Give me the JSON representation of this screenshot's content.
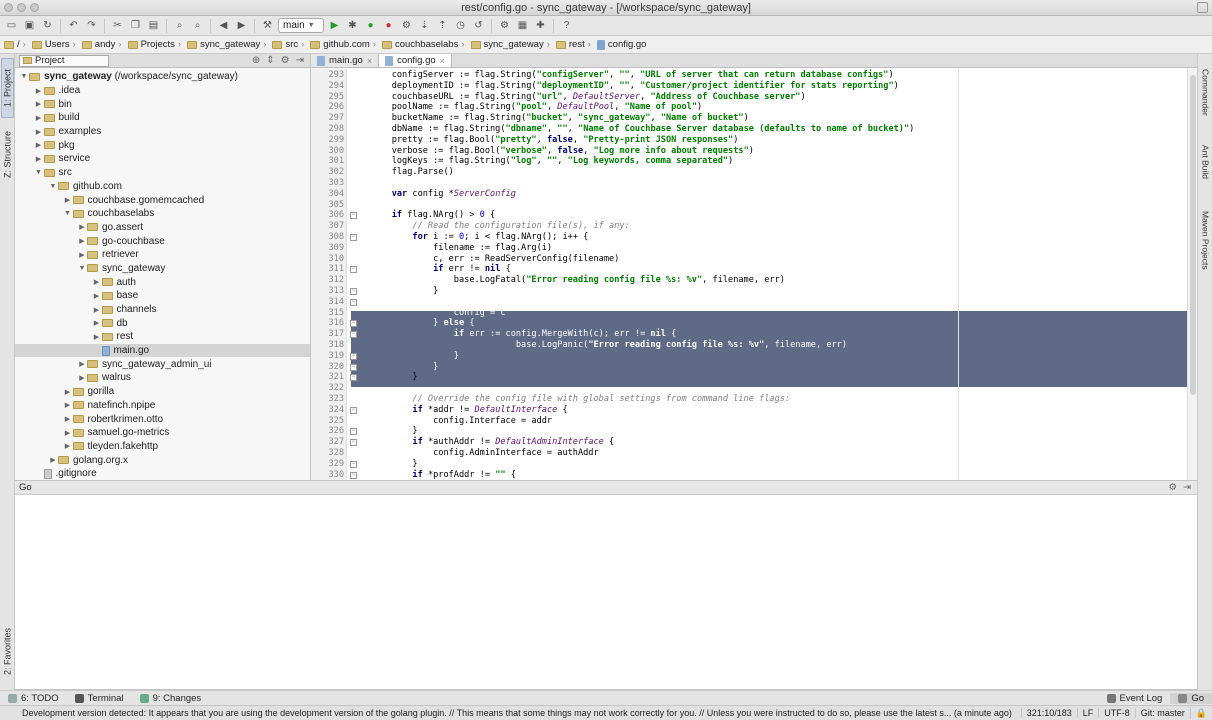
{
  "window": {
    "title": "rest/config.go - sync_gateway - [/workspace/sync_gateway]"
  },
  "toolbar": {
    "run_config": "main"
  },
  "breadcrumb": [
    {
      "label": "/",
      "kind": "folder"
    },
    {
      "label": "Users",
      "kind": "folder"
    },
    {
      "label": "andy",
      "kind": "folder"
    },
    {
      "label": "Projects",
      "kind": "folder"
    },
    {
      "label": "sync_gateway",
      "kind": "folder"
    },
    {
      "label": "src",
      "kind": "folder"
    },
    {
      "label": "github.com",
      "kind": "folder"
    },
    {
      "label": "couchbaselabs",
      "kind": "folder"
    },
    {
      "label": "sync_gateway",
      "kind": "folder"
    },
    {
      "label": "rest",
      "kind": "folder"
    },
    {
      "label": "config.go",
      "kind": "file"
    }
  ],
  "left_stripe": {
    "project_tab": "1: Project",
    "structure_tab": "Z: Structure",
    "favorites_tab": "2: Favorites"
  },
  "right_stripe": {
    "commander_tab": "Commander",
    "ant_tab": "Ant Build",
    "maven_tab": "Maven Projects"
  },
  "project_panel": {
    "selector": "Project",
    "tree": [
      {
        "label": "sync_gateway",
        "suffix": " (/workspace/sync_gateway)",
        "depth": 0,
        "state": "open",
        "icon": "folder",
        "bold": true
      },
      {
        "label": ".idea",
        "depth": 1,
        "state": "closed",
        "icon": "folder"
      },
      {
        "label": "bin",
        "depth": 1,
        "state": "closed",
        "icon": "folder"
      },
      {
        "label": "build",
        "depth": 1,
        "state": "closed",
        "icon": "folder"
      },
      {
        "label": "examples",
        "depth": 1,
        "state": "closed",
        "icon": "folder"
      },
      {
        "label": "pkg",
        "depth": 1,
        "state": "closed",
        "icon": "folder"
      },
      {
        "label": "service",
        "depth": 1,
        "state": "closed",
        "icon": "folder"
      },
      {
        "label": "src",
        "depth": 1,
        "state": "open",
        "icon": "folder"
      },
      {
        "label": "github.com",
        "depth": 2,
        "state": "open",
        "icon": "folder"
      },
      {
        "label": "couchbase.gomemcached",
        "depth": 3,
        "state": "closed",
        "icon": "folder"
      },
      {
        "label": "couchbaselabs",
        "depth": 3,
        "state": "open",
        "icon": "folder"
      },
      {
        "label": "go.assert",
        "depth": 4,
        "state": "closed",
        "icon": "folder"
      },
      {
        "label": "go-couchbase",
        "depth": 4,
        "state": "closed",
        "icon": "folder"
      },
      {
        "label": "retriever",
        "depth": 4,
        "state": "closed",
        "icon": "folder"
      },
      {
        "label": "sync_gateway",
        "depth": 4,
        "state": "open",
        "icon": "folder"
      },
      {
        "label": "auth",
        "depth": 5,
        "state": "closed",
        "icon": "folder"
      },
      {
        "label": "base",
        "depth": 5,
        "state": "closed",
        "icon": "folder"
      },
      {
        "label": "channels",
        "depth": 5,
        "state": "closed",
        "icon": "folder"
      },
      {
        "label": "db",
        "depth": 5,
        "state": "closed",
        "icon": "folder"
      },
      {
        "label": "rest",
        "depth": 5,
        "state": "closed",
        "icon": "folder"
      },
      {
        "label": "main.go",
        "depth": 5,
        "state": "none",
        "icon": "file",
        "selected": true
      },
      {
        "label": "sync_gateway_admin_ui",
        "depth": 4,
        "state": "closed",
        "icon": "folder"
      },
      {
        "label": "walrus",
        "depth": 4,
        "state": "closed",
        "icon": "folder"
      },
      {
        "label": "gorilla",
        "depth": 3,
        "state": "closed",
        "icon": "folder"
      },
      {
        "label": "natefinch.npipe",
        "depth": 3,
        "state": "closed",
        "icon": "folder"
      },
      {
        "label": "robertkrimen.otto",
        "depth": 3,
        "state": "closed",
        "icon": "folder"
      },
      {
        "label": "samuel.go-metrics",
        "depth": 3,
        "state": "closed",
        "icon": "folder"
      },
      {
        "label": "tleyden.fakehttp",
        "depth": 3,
        "state": "closed",
        "icon": "folder"
      },
      {
        "label": "golang.org.x",
        "depth": 2,
        "state": "closed",
        "icon": "folder"
      },
      {
        "label": ".gitignore",
        "depth": 1,
        "state": "none",
        "icon": "git"
      }
    ]
  },
  "editor": {
    "tabs": [
      {
        "label": "main.go",
        "active": false
      },
      {
        "label": "config.go",
        "active": true
      }
    ],
    "lines": [
      {
        "n": "293",
        "html": "\tconfigServer := flag.String(<span class=\"str\">\"configServer\"</span>, <span class=\"str\">\"\"</span>, <span class=\"str\">\"URL of server that can return database configs\"</span>)"
      },
      {
        "n": "294",
        "html": "\tdeploymentID := flag.String(<span class=\"str\">\"deploymentID\"</span>, <span class=\"str\">\"\"</span>, <span class=\"str\">\"Customer/project identifier for stats reporting\"</span>)"
      },
      {
        "n": "295",
        "html": "\tcouchbaseURL := flag.String(<span class=\"str\">\"url\"</span>, <span class=\"it\">DefaultServer</span>, <span class=\"str\">\"Address of Couchbase server\"</span>)"
      },
      {
        "n": "296",
        "html": "\tpoolName := flag.String(<span class=\"str\">\"pool\"</span>, <span class=\"it\">DefaultPool</span>, <span class=\"str\">\"Name of pool\"</span>)"
      },
      {
        "n": "297",
        "html": "\tbucketName := flag.String(<span class=\"str\">\"bucket\"</span>, <span class=\"str\">\"sync_gateway\"</span>, <span class=\"str\">\"Name of bucket\"</span>)"
      },
      {
        "n": "298",
        "html": "\tdbName := flag.String(<span class=\"str\">\"dbname\"</span>, <span class=\"str\">\"\"</span>, <span class=\"str\">\"Name of Couchbase Server database (defaults to name of bucket)\"</span>)"
      },
      {
        "n": "299",
        "html": "\tpretty := flag.Bool(<span class=\"str\">\"pretty\"</span>, <span class=\"kw\">false</span>, <span class=\"str\">\"Pretty-print JSON responses\"</span>)"
      },
      {
        "n": "300",
        "html": "\tverbose := flag.Bool(<span class=\"str\">\"verbose\"</span>, <span class=\"kw\">false</span>, <span class=\"str\">\"Log more info about requests\"</span>)"
      },
      {
        "n": "301",
        "html": "\tlogKeys := flag.String(<span class=\"str\">\"log\"</span>, <span class=\"str\">\"\"</span>, <span class=\"str\">\"Log keywords, comma separated\"</span>)"
      },
      {
        "n": "302",
        "html": "\tflag.Parse()"
      },
      {
        "n": "303",
        "html": ""
      },
      {
        "n": "304",
        "html": "\t<span class=\"kw\">var</span> config *<span class=\"it\">ServerConfig</span>"
      },
      {
        "n": "305",
        "html": ""
      },
      {
        "n": "306",
        "html": "\t<span class=\"kw\">if</span> flag.NArg() &gt; <span class=\"num\">0</span> {"
      },
      {
        "n": "307",
        "html": "\t\t<span class=\"cm\">// Read the configuration file(s), if any:</span>"
      },
      {
        "n": "308",
        "html": "\t\t<span class=\"kw\">for</span> i := <span class=\"num\">0</span>; i &lt; flag.NArg(); i++ {"
      },
      {
        "n": "309",
        "html": "\t\t\tfilename := flag.Arg(i)"
      },
      {
        "n": "310",
        "html": "\t\t\tc, err := ReadServerConfig(filename)"
      },
      {
        "n": "311",
        "html": "\t\t\t<span class=\"kw\">if</span> err != <span class=\"kw\">nil</span> {"
      },
      {
        "n": "312",
        "html": "\t\t\t\tbase.LogFatal(<span class=\"str\">\"Error reading config file %s: %v\"</span>, filename, err)"
      },
      {
        "n": "313",
        "html": "\t\t\t}"
      },
      {
        "n": "314",
        "html": "\t\t\t<span class=\"kw\">if</span> config == <span class=\"kw\">nil</span> {",
        "sel": true
      },
      {
        "n": "315",
        "html": "\t\t\t\tconfig = c",
        "sel": true
      },
      {
        "n": "316",
        "html": "\t\t\t} <span class=\"kw\">else</span> {",
        "sel": true
      },
      {
        "n": "317",
        "html": "\t\t\t\t<span class=\"kw\">if</span> err := config.MergeWith(c); err != <span class=\"kw\">nil</span> {",
        "sel": true
      },
      {
        "n": "318",
        "html": "\t\t\t\t\t\t\tbase.LogPanic(<span class=\"str\">\"Error reading config file %s: %v\"</span>, filename, err)",
        "sel": true
      },
      {
        "n": "319",
        "html": "\t\t\t\t}",
        "sel": true
      },
      {
        "n": "320",
        "html": "\t\t\t}",
        "sel": true
      },
      {
        "n": "321",
        "html": "\t\t}"
      },
      {
        "n": "322",
        "html": ""
      },
      {
        "n": "323",
        "html": "\t\t<span class=\"cm\">// Override the config file with global settings from command line flags:</span>"
      },
      {
        "n": "324",
        "html": "\t\t<span class=\"kw\">if</span> *addr != <span class=\"it\">DefaultInterface</span> {"
      },
      {
        "n": "325",
        "html": "\t\t\tconfig.Interface = addr"
      },
      {
        "n": "326",
        "html": "\t\t}"
      },
      {
        "n": "327",
        "html": "\t\t<span class=\"kw\">if</span> *authAddr != <span class=\"it\">DefaultAdminInterface</span> {"
      },
      {
        "n": "328",
        "html": "\t\t\tconfig.AdminInterface = authAddr"
      },
      {
        "n": "329",
        "html": "\t\t}"
      },
      {
        "n": "330",
        "html": "\t\t<span class=\"kw\">if</span> *profAddr != <span class=\"str\">\"\"</span> {"
      }
    ]
  },
  "bottom_panel": {
    "title": "Go"
  },
  "tool_tabs": {
    "todo": "6: TODO",
    "terminal": "Terminal",
    "changes": "9: Changes",
    "event_log": "Event Log",
    "go": "Go"
  },
  "status_bar": {
    "message": "Development version detected: It appears that you are using the development version of the golang plugin. // This means that some things may not work correctly for you. // Unless you were instructed to do so, please use the latest s... (a minute ago)",
    "position": "321:10/183",
    "line_sep": "LF",
    "encoding": "UTF-8",
    "vcs": "Git: master"
  }
}
